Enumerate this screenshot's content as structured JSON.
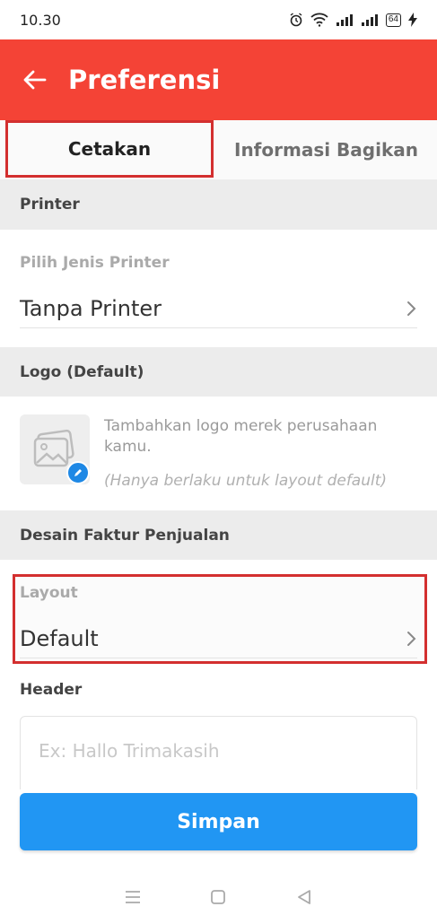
{
  "status_bar": {
    "time": "10.30",
    "battery": "64",
    "icons": [
      "alarm-icon",
      "wifi-icon",
      "signal-icon",
      "signal-icon",
      "battery-icon",
      "charging-icon"
    ]
  },
  "app_bar": {
    "title": "Preferensi",
    "back_icon": "arrow-left-icon",
    "color": "#f44336"
  },
  "tabs": [
    {
      "label": "Cetakan",
      "active": true
    },
    {
      "label": "Informasi Bagikan",
      "active": false
    }
  ],
  "printer_section": {
    "header": "Printer",
    "field_label": "Pilih Jenis Printer",
    "value": "Tanpa Printer"
  },
  "logo_section": {
    "header": "Logo (Default)",
    "description": "Tambahkan logo merek perusahaan kamu.",
    "note": "(Hanya berlaku untuk layout default)"
  },
  "invoice_section": {
    "header": "Desain Faktur Penjualan",
    "layout_label": "Layout",
    "layout_value": "Default",
    "header_label": "Header",
    "header_placeholder": "Ex: Hallo Trimakasih"
  },
  "save_button": {
    "label": "Simpan",
    "color": "#2196f3"
  },
  "nav_bar": {
    "icons": [
      "menu-icon",
      "home-icon",
      "back-icon"
    ]
  }
}
